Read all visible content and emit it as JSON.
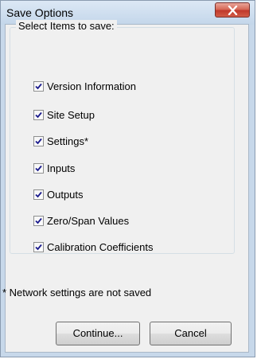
{
  "window": {
    "title": "Save Options",
    "close_icon": "close-x-icon"
  },
  "group": {
    "legend": "Select Items to save:",
    "items": [
      {
        "label": "Version Information",
        "checked": true
      },
      {
        "label": "Site Setup",
        "checked": true
      },
      {
        "label": "Settings*",
        "checked": true
      },
      {
        "label": "Inputs",
        "checked": true
      },
      {
        "label": "Outputs",
        "checked": true
      },
      {
        "label": "Zero/Span Values",
        "checked": true
      },
      {
        "label": "Calibration Coefficients",
        "checked": true
      }
    ]
  },
  "note": "* Network settings are not saved",
  "buttons": {
    "continue": "Continue...",
    "cancel": "Cancel"
  },
  "colors": {
    "check": "#1a1a8c",
    "close_button": "#c0392b"
  }
}
